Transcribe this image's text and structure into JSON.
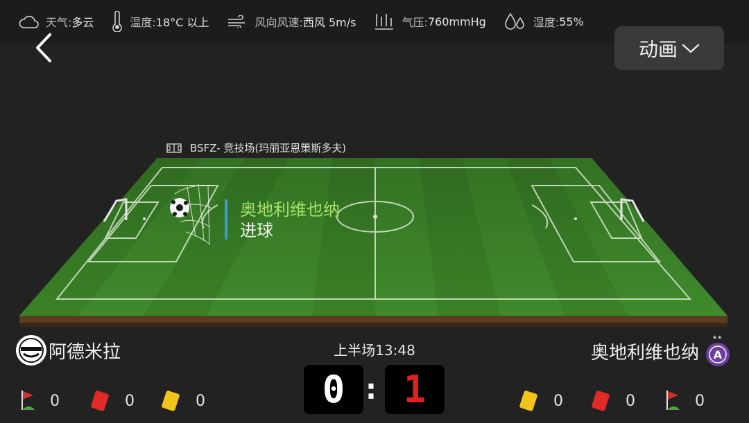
{
  "weather": {
    "condition": {
      "label": "天气:",
      "value": "多云"
    },
    "temperature": {
      "label": "温度:",
      "value": "18°C 以上"
    },
    "wind": {
      "label": "风向风速:",
      "value": "西风 5m/s"
    },
    "pressure": {
      "label": "气压:",
      "value": "760mmHg"
    },
    "humidity": {
      "label": "湿度:",
      "value": "55%"
    }
  },
  "header": {
    "animation_label": "动画"
  },
  "venue": {
    "name": "BSFZ- 竞技场(玛丽亚恩策斯多夫)"
  },
  "event": {
    "team": "奥地利维也纳",
    "type": "进球"
  },
  "match": {
    "time": "上半场13:48"
  },
  "home": {
    "name": "阿德米拉",
    "score": "0",
    "corners": "0",
    "red_cards": "0",
    "yellow_cards": "0"
  },
  "away": {
    "name": "奥地利维也纳",
    "score": "1",
    "corners": "0",
    "red_cards": "0",
    "yellow_cards": "0"
  },
  "colors": {
    "event_team": "#a6e06a",
    "event_bar": "#3e9ad9",
    "away_score": "#e0201c",
    "pitch": "#3f8a2b"
  }
}
